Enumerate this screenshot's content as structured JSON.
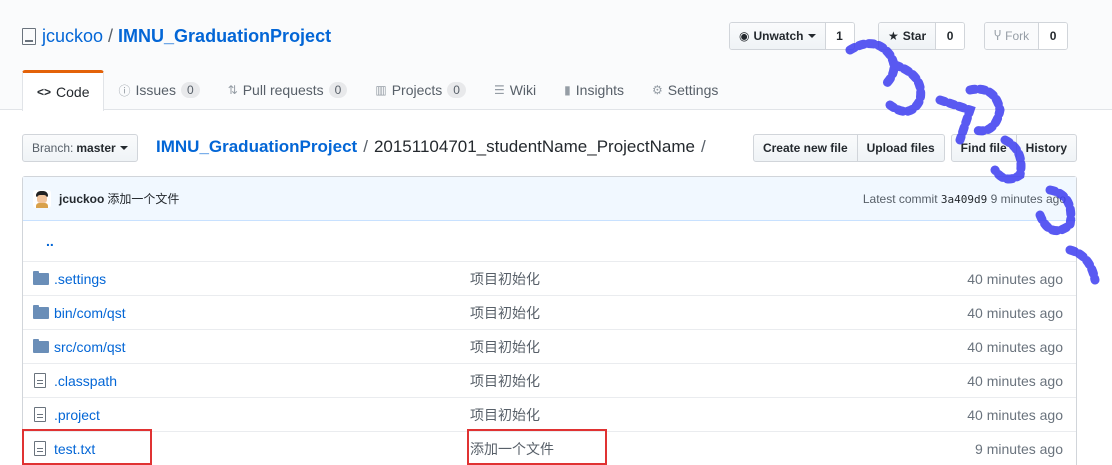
{
  "repo": {
    "owner": "jcuckoo",
    "separator": "/",
    "name": "IMNU_GraduationProject"
  },
  "actions": {
    "unwatch": {
      "label": "Unwatch",
      "count": "1"
    },
    "star": {
      "label": "Star",
      "count": "0"
    },
    "fork": {
      "label": "Fork",
      "count": "0"
    }
  },
  "tabs": [
    {
      "icon": "code-icon",
      "glyph": "<>",
      "label": "Code",
      "count": null
    },
    {
      "icon": "issue-icon",
      "glyph": "ⓘ",
      "label": "Issues",
      "count": "0"
    },
    {
      "icon": "pull-request-icon",
      "glyph": "⇅",
      "label": "Pull requests",
      "count": "0"
    },
    {
      "icon": "project-icon",
      "glyph": "▥",
      "label": "Projects",
      "count": "0"
    },
    {
      "icon": "wiki-icon",
      "glyph": "☰",
      "label": "Wiki",
      "count": null
    },
    {
      "icon": "insights-icon",
      "glyph": "▮",
      "label": "Insights",
      "count": null
    },
    {
      "icon": "gear-icon",
      "glyph": "⚙",
      "label": "Settings",
      "count": null
    }
  ],
  "branch": {
    "label": "Branch:",
    "value": "master"
  },
  "breadcrumb": {
    "root": "IMNU_GraduationProject",
    "sep": "/",
    "current": "20151104701_studentName_ProjectName",
    "trail": "/"
  },
  "file_nav": {
    "create": "Create new file",
    "upload": "Upload files",
    "find": "Find file",
    "history": "History"
  },
  "commit": {
    "author": "jcuckoo",
    "message": "添加一个文件",
    "latest_label": "Latest commit",
    "sha": "3a409d9",
    "time": "9 minutes ago"
  },
  "parent_dir": "..",
  "files": [
    {
      "type": "dir",
      "name": ".settings",
      "message": "项目初始化",
      "age": "40 minutes ago"
    },
    {
      "type": "dir",
      "name": "bin/com/qst",
      "message": "项目初始化",
      "age": "40 minutes ago"
    },
    {
      "type": "dir",
      "name": "src/com/qst",
      "message": "项目初始化",
      "age": "40 minutes ago"
    },
    {
      "type": "file",
      "name": ".classpath",
      "message": "项目初始化",
      "age": "40 minutes ago"
    },
    {
      "type": "file",
      "name": ".project",
      "message": "项目初始化",
      "age": "40 minutes ago"
    },
    {
      "type": "file",
      "name": "test.txt",
      "message": "添加一个文件",
      "age": "9 minutes ago"
    }
  ],
  "colors": {
    "link": "#0366d6",
    "highlight": "#e03232",
    "tab_accent": "#e36209",
    "watermark": "#3d3df0"
  }
}
